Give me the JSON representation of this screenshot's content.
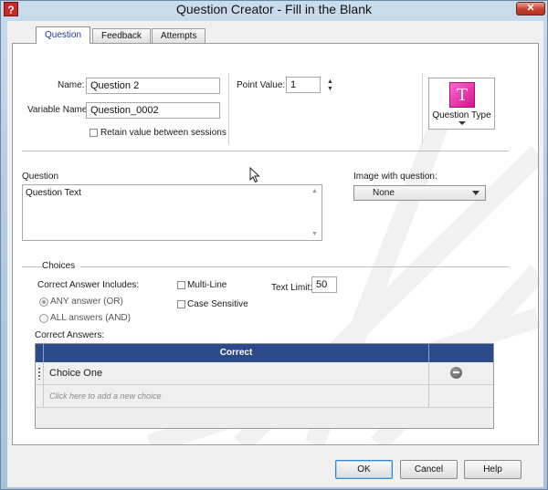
{
  "window": {
    "title": "Question Creator - Fill in the Blank",
    "app_icon_glyph": "?",
    "close_glyph": "✕"
  },
  "tabs": [
    {
      "label": "Question",
      "active": true
    },
    {
      "label": "Feedback",
      "active": false
    },
    {
      "label": "Attempts",
      "active": false
    }
  ],
  "form": {
    "name_label": "Name:",
    "name_value": "Question 2",
    "variable_label": "Variable Name:",
    "variable_value": "Question_0002",
    "retain_label": "Retain value between sessions",
    "point_value_label": "Point Value:",
    "point_value": "1",
    "question_type_label": "Question Type",
    "question_type_icon_glyph": "T"
  },
  "question": {
    "label": "Question",
    "text": "Question Text"
  },
  "image": {
    "label": "Image with question:",
    "selected": "None"
  },
  "choices": {
    "section_label": "Choices",
    "includes_label": "Correct Answer Includes:",
    "option_any": "ANY answer (OR)",
    "option_all": "ALL answers (AND)",
    "multiline_label": "Multi-Line",
    "case_label": "Case Sensitive",
    "text_limit_label": "Text Limit:",
    "text_limit": "50",
    "correct_answers_label": "Correct Answers:",
    "column_header": "Correct",
    "rows": [
      {
        "text": "Choice One"
      }
    ],
    "add_placeholder": "Click here to add a new choice"
  },
  "buttons": {
    "ok": "OK",
    "cancel": "Cancel",
    "help": "Help"
  },
  "colors": {
    "grid_header": "#2b4a8a",
    "tab_active_text": "#1f3b8c",
    "question_type_icon": "#e63fb4",
    "close_button": "#c4402b"
  }
}
